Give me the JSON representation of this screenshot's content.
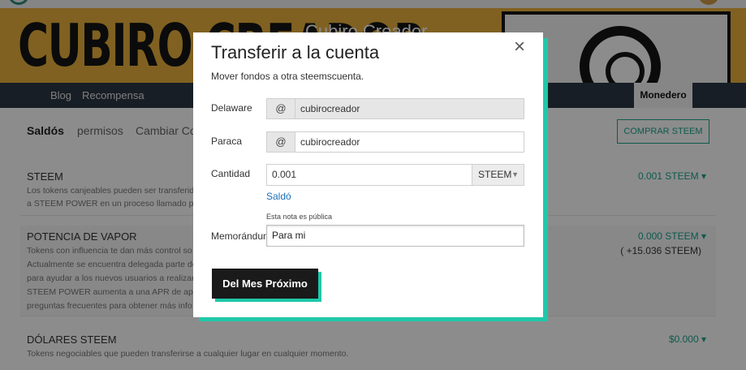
{
  "banner": {
    "title": "CUBIRO CREADOR",
    "subtitle": "Cubiro Creador"
  },
  "nav": {
    "blog": "Blog",
    "rewards": "Recompensa",
    "wallet": "Monedero"
  },
  "subnav": {
    "balances": "Saldós",
    "permissions": "permisos",
    "change_password": "Cambiar Co",
    "buy_button": "COMPRAR STEEM"
  },
  "accounts": [
    {
      "title": "STEEM",
      "desc_lines": [
        "Los tokens canjeables pueden ser transferidos",
        "a STEEM POWER en un proceso llamado p"
      ],
      "amount": "0.001 STEEM ▾"
    },
    {
      "title": "POTENCIA DE VAPOR",
      "desc_lines": [
        "Tokens con influencia te dan más control so",
        "Actualmente se encuentra delegada parte de",
        "para ayudar a los nuevos usuarios a realizar",
        "STEEM POWER aumenta a una APR de ap",
        "preguntas frecuentes para obtener más info"
      ],
      "amount": "0.000 STEEM ▾",
      "extra": "( +15.036 STEEM)"
    },
    {
      "title": "DÓLARES STEEM",
      "desc_lines": [
        "Tokens negociables que pueden transferirse a cualquier lugar en cualquier momento."
      ],
      "amount": "$0.000 ▾"
    }
  ],
  "modal": {
    "close": "×",
    "title": "Transferir a la cuenta",
    "subtitle": "Mover fondos a otra steemscuenta.",
    "from_label": "Delaware",
    "from_value": "cubirocreador",
    "to_label": "Paraca",
    "to_value": "cubirocreador",
    "at_symbol": "@",
    "amount_label": "Cantidad",
    "amount_value": "0.001",
    "asset": "STEEM",
    "asset_caret": "▼",
    "balance_link": "Saldó",
    "memo_note": "Esta nota es pública",
    "memo_label": "Memorándum",
    "memo_value": "Para mi",
    "submit": "Del Mes Próximo"
  },
  "colors": {
    "accent": "#1fc8a9",
    "banner": "#e9b13c",
    "navbar": "#2d3844",
    "button": "#1a1a1a",
    "link": "#1d6fb8"
  }
}
